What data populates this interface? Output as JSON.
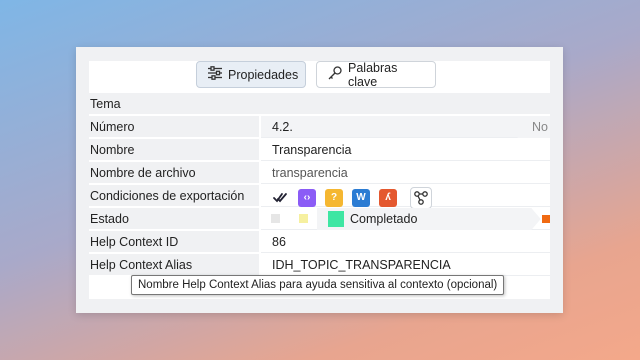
{
  "toolbar": {
    "properties_label": "Propiedades",
    "keywords_label": "Palabras clave"
  },
  "properties": {
    "section_title": "Tema",
    "numero": {
      "label": "Número",
      "value": "4.2.",
      "trailing": "No"
    },
    "nombre": {
      "label": "Nombre",
      "value": "Transparencia"
    },
    "archivo": {
      "label": "Nombre de archivo",
      "value": "transparencia"
    },
    "export": {
      "label": "Condiciones de exportación",
      "icons": [
        "check-all-icon",
        "code-html-icon",
        "help-chm-icon",
        "word-icon",
        "pdf-icon",
        "share-nodes-icon"
      ],
      "colors": {
        "code": "#8b5cf6",
        "help": "#f5b731",
        "word": "#2b7cd3",
        "pdf": "#e4582f"
      }
    },
    "estado": {
      "label": "Estado",
      "value": "Completado",
      "colors": {
        "done": "#3ee6a3",
        "pending": "#f6f0a0",
        "none": "#e6e6e6",
        "next": "#f06a12"
      }
    },
    "help_id": {
      "label": "Help Context ID",
      "value": "86"
    },
    "help_alias": {
      "label": "Help Context Alias",
      "value": "IDH_TOPIC_TRANSPARENCIA"
    }
  },
  "tooltip": {
    "text": "Nombre Help Context Alias para ayuda sensitiva al contexto (opcional)"
  }
}
